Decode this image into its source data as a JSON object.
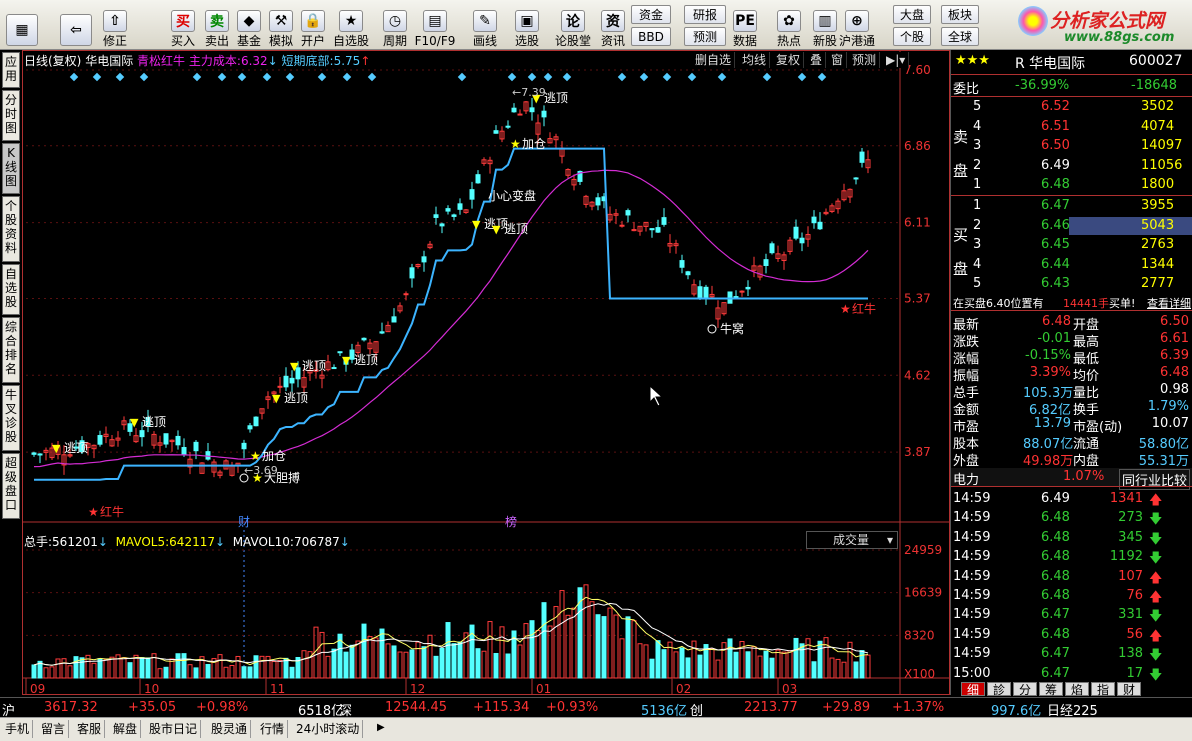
{
  "toolbar": {
    "buttons": [
      {
        "label": "",
        "icon": "app-grid-icon",
        "glyph": "▦"
      },
      {
        "label": "",
        "icon": "back-arrow-icon",
        "glyph": "⇦"
      },
      {
        "label": "修正",
        "icon": "revise-icon",
        "glyph": "⇧"
      },
      {
        "label": "买入",
        "icon": "buy-icon",
        "glyph": "买"
      },
      {
        "label": "卖出",
        "icon": "sell-icon",
        "glyph": "卖"
      },
      {
        "label": "基金",
        "icon": "fund-icon",
        "glyph": "◆"
      },
      {
        "label": "模拟",
        "icon": "hammer-icon",
        "glyph": "⚒"
      },
      {
        "label": "开户",
        "icon": "lock-icon",
        "glyph": "🔒"
      },
      {
        "label": "自选股",
        "icon": "star-icon",
        "glyph": "★"
      },
      {
        "label": "周期",
        "icon": "clock-icon",
        "glyph": "◷"
      },
      {
        "label": "F10/F9",
        "icon": "f10-icon",
        "glyph": "▤"
      },
      {
        "label": "画线",
        "icon": "pen-icon",
        "glyph": "✎"
      },
      {
        "label": "选股",
        "icon": "screen-icon",
        "glyph": "▣"
      },
      {
        "label": "论股堂",
        "icon": "forum-icon",
        "glyph": "论"
      },
      {
        "label": "资讯",
        "icon": "info-icon",
        "glyph": "资"
      },
      {
        "label": "数据",
        "icon": "pe-icon",
        "glyph": "PE"
      },
      {
        "label": "热点",
        "icon": "hotspot-icon",
        "glyph": "✿"
      },
      {
        "label": "新股",
        "icon": "newstock-icon",
        "glyph": "▥"
      },
      {
        "label": "沪港通",
        "icon": "shhk-icon",
        "glyph": "⊕"
      }
    ],
    "small_buttons": [
      "资金",
      "BBD",
      "研报",
      "预测",
      "大盘",
      "个股",
      "板块",
      "全球"
    ],
    "logo_title": "分析家公式网",
    "logo_url": "www.88gs.com"
  },
  "sidetabs": [
    "应用",
    "分时图",
    "K线图",
    "个股资料",
    "自选股",
    "综合排名",
    "牛叉诊股",
    "超级盘口"
  ],
  "chart": {
    "header": {
      "period": "日线(复权)",
      "stock": "华电国际",
      "indicator1": "青松红牛",
      "cost_label": "主力成本:",
      "cost_value": "6.32",
      "bottom_label": "短期底部:",
      "bottom_value": "5.75"
    },
    "tools": [
      "删自选",
      "均线",
      "复权",
      "叠",
      "窗",
      "预测"
    ],
    "price_ticks": [
      "7.60",
      "6.86",
      "6.11",
      "5.37",
      "4.62",
      "3.87"
    ],
    "volume_header": {
      "total_label": "总手:",
      "total": "561201",
      "ma5_label": "MAVOL5:",
      "ma5": "642117",
      "ma10_label": "MAVOL10:",
      "ma10": "706787",
      "selector": "成交量"
    },
    "volume_ticks": [
      "24959",
      "16639",
      "8320",
      "X100"
    ],
    "x_ticks": [
      "09",
      "10",
      "11",
      "12",
      "01",
      "02",
      "03"
    ],
    "annotations": {
      "high_value": "7.39",
      "low_value": "3.69",
      "escape_top": "逃顶",
      "add_position": "加仓",
      "careful": "小心变盘",
      "bull_nest": "牛窝",
      "red_bull": "红牛",
      "bold_grab": "大胆搏",
      "finance_mark": "财",
      "list_mark": "榜"
    },
    "colors": {
      "up": "#ff3b3b",
      "down": "#54ffff",
      "ma_magenta": "#d42cd4",
      "support": "#3cb4ff",
      "yellow": "#ffff00"
    }
  },
  "chart_data": {
    "type": "candlestick",
    "title": "华电国际 日线(复权)",
    "x": [
      "09",
      "10",
      "11",
      "12",
      "01",
      "02",
      "03"
    ],
    "ylim": [
      3.5,
      7.6
    ],
    "price_series_approx": [
      3.85,
      3.9,
      3.95,
      4.1,
      4.05,
      3.95,
      3.8,
      3.7,
      4.4,
      4.55,
      4.7,
      4.8,
      5.0,
      5.4,
      6.1,
      6.2,
      6.9,
      7.3,
      7.0,
      6.5,
      6.2,
      6.1,
      6.0,
      5.5,
      5.3,
      5.6,
      5.8,
      6.0,
      6.4,
      6.7
    ],
    "series": [
      {
        "name": "主力成本",
        "values": [
          6.32
        ]
      },
      {
        "name": "短期底部",
        "values": [
          5.75
        ]
      }
    ],
    "volume": {
      "ylim": [
        0,
        24959
      ],
      "MAVOL5": 642117,
      "MAVOL10": 706787,
      "total": 561201
    }
  },
  "quote": {
    "stars": "★★★",
    "name": "R 华电国际",
    "code": "600027",
    "wei_label": "委比",
    "wei_value": "-36.99%",
    "wei_diff": "-18648",
    "sell_label": "卖盘",
    "buy_label": "买盘",
    "sells": [
      {
        "n": "5",
        "p": "6.52",
        "v": "3502"
      },
      {
        "n": "4",
        "p": "6.51",
        "v": "4074"
      },
      {
        "n": "3",
        "p": "6.50",
        "v": "14097"
      },
      {
        "n": "2",
        "p": "6.49",
        "v": "11056"
      },
      {
        "n": "1",
        "p": "6.48",
        "v": "1800"
      }
    ],
    "buys": [
      {
        "n": "1",
        "p": "6.47",
        "v": "3955"
      },
      {
        "n": "2",
        "p": "6.46",
        "v": "5043"
      },
      {
        "n": "3",
        "p": "6.45",
        "v": "2763"
      },
      {
        "n": "4",
        "p": "6.44",
        "v": "1344"
      },
      {
        "n": "5",
        "p": "6.43",
        "v": "2777"
      }
    ],
    "notice": "在买盘6.40位置有",
    "notice_vol": "14441手",
    "notice_tail": "买单!",
    "notice_link": "查看详细",
    "stats": [
      {
        "l1": "最新",
        "v1": "6.48",
        "l2": "开盘",
        "v2": "6.50"
      },
      {
        "l1": "涨跌",
        "v1": "-0.01",
        "l2": "最高",
        "v2": "6.61"
      },
      {
        "l1": "涨幅",
        "v1": "-0.15%",
        "l2": "最低",
        "v2": "6.39"
      },
      {
        "l1": "振幅",
        "v1": "3.39%",
        "l2": "均价",
        "v2": "6.48"
      },
      {
        "l1": "总手",
        "v1": "105.3万",
        "l2": "量比",
        "v2": "0.98"
      },
      {
        "l1": "金额",
        "v1": "6.82亿",
        "l2": "换手",
        "v2": "1.79%"
      },
      {
        "l1": "市盈",
        "v1": "13.79",
        "l2": "市盈(动)",
        "v2": "10.07"
      },
      {
        "l1": "股本",
        "v1": "88.07亿",
        "l2": "流通",
        "v2": "58.80亿"
      },
      {
        "l1": "外盘",
        "v1": "49.98万",
        "l2": "内盘",
        "v2": "55.31万"
      }
    ],
    "sector": "电力",
    "sector_pct": "1.07%",
    "sector_compare": "同行业比较",
    "ticks": [
      {
        "t": "14:59",
        "p": "6.49",
        "v": "1341",
        "d": "up"
      },
      {
        "t": "14:59",
        "p": "6.48",
        "v": "273",
        "d": "down"
      },
      {
        "t": "14:59",
        "p": "6.48",
        "v": "345",
        "d": "down"
      },
      {
        "t": "14:59",
        "p": "6.48",
        "v": "1192",
        "d": "down"
      },
      {
        "t": "14:59",
        "p": "6.48",
        "v": "107",
        "d": "up"
      },
      {
        "t": "14:59",
        "p": "6.48",
        "v": "76",
        "d": "up"
      },
      {
        "t": "14:59",
        "p": "6.47",
        "v": "331",
        "d": "down"
      },
      {
        "t": "14:59",
        "p": "6.48",
        "v": "56",
        "d": "up"
      },
      {
        "t": "14:59",
        "p": "6.47",
        "v": "138",
        "d": "down"
      },
      {
        "t": "15:00",
        "p": "6.47",
        "v": "17",
        "d": "down"
      }
    ],
    "bottom_tabs": [
      "细",
      "診",
      "分",
      "筹",
      "焰",
      "指",
      "财"
    ]
  },
  "status": {
    "sh_label": "沪",
    "sh_index": "3617.32",
    "sh_chg": "+35.05",
    "sh_pct": "+0.98%",
    "sh_amt": "6518亿",
    "sz_label": "深",
    "sz_index": "12544.45",
    "sz_chg": "+115.34",
    "sz_pct": "+0.93%",
    "sz_amt": "5136亿",
    "cy_label": "创",
    "cy_index": "2213.77",
    "cy_chg": "+29.89",
    "cy_pct": "+1.37%",
    "cy_amt": "997.6亿",
    "nk_label": "日经225"
  },
  "bottombar": [
    "手机",
    "留言",
    "客服",
    "解盘",
    "股市日记",
    "股灵通",
    "行情",
    "24小时滚动"
  ]
}
